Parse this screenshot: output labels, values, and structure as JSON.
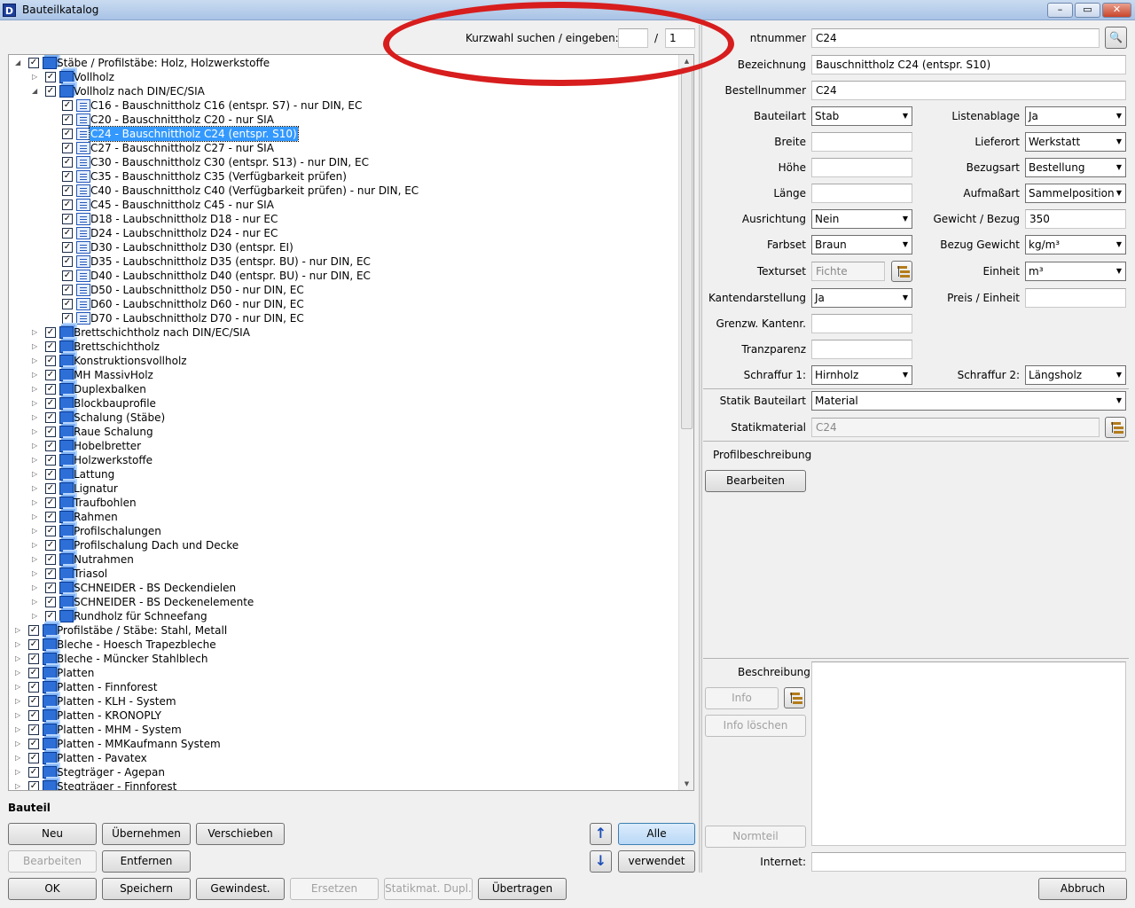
{
  "window": {
    "title": "Bauteilkatalog",
    "controls": [
      "–",
      "▭",
      "✕"
    ]
  },
  "search": {
    "label": "Kurzwahl suchen / eingeben:",
    "value": "",
    "separator": "/",
    "count": "1"
  },
  "tree": {
    "items": [
      {
        "label": "Stäbe / Profilstäbe: Holz, Holzwerkstoffe",
        "level": 0,
        "expanded": true,
        "type": "folder"
      },
      {
        "label": "Vollholz",
        "level": 1,
        "expanded": false,
        "type": "folder"
      },
      {
        "label": "Vollholz nach DIN/EC/SIA",
        "level": 1,
        "expanded": true,
        "type": "folder"
      },
      {
        "label": "C16 - Bauschnittholz C16 (entspr. S7) - nur DIN, EC",
        "level": 2,
        "type": "item"
      },
      {
        "label": "C20 - Bauschnittholz C20 - nur SIA",
        "level": 2,
        "type": "item"
      },
      {
        "label": "C24 - Bauschnittholz C24 (entspr. S10)",
        "level": 2,
        "type": "item",
        "selected": true
      },
      {
        "label": "C27 - Bauschnittholz C27 - nur SIA",
        "level": 2,
        "type": "item"
      },
      {
        "label": "C30 - Bauschnittholz C30 (entspr. S13) - nur DIN, EC",
        "level": 2,
        "type": "item"
      },
      {
        "label": "C35 - Bauschnittholz C35 (Verfügbarkeit prüfen)",
        "level": 2,
        "type": "item"
      },
      {
        "label": "C40 - Bauschnittholz C40 (Verfügbarkeit prüfen) - nur DIN, EC",
        "level": 2,
        "type": "item"
      },
      {
        "label": "C45 - Bauschnittholz C45 - nur SIA",
        "level": 2,
        "type": "item"
      },
      {
        "label": "D18 - Laubschnittholz D18 - nur EC",
        "level": 2,
        "type": "item"
      },
      {
        "label": "D24 - Laubschnittholz D24 - nur EC",
        "level": 2,
        "type": "item"
      },
      {
        "label": "D30 - Laubschnittholz D30 (entspr. EI)",
        "level": 2,
        "type": "item"
      },
      {
        "label": "D35 - Laubschnittholz D35 (entspr. BU) - nur DIN, EC",
        "level": 2,
        "type": "item"
      },
      {
        "label": "D40 - Laubschnittholz D40 (entspr. BU) - nur DIN, EC",
        "level": 2,
        "type": "item"
      },
      {
        "label": "D50 - Laubschnittholz D50 - nur DIN, EC",
        "level": 2,
        "type": "item"
      },
      {
        "label": "D60 - Laubschnittholz D60 - nur DIN, EC",
        "level": 2,
        "type": "item"
      },
      {
        "label": "D70 - Laubschnittholz D70 - nur DIN, EC",
        "level": 2,
        "type": "item"
      },
      {
        "label": "Brettschichtholz nach DIN/EC/SIA",
        "level": 1,
        "expanded": false,
        "type": "folder"
      },
      {
        "label": "Brettschichtholz",
        "level": 1,
        "expanded": false,
        "type": "folder"
      },
      {
        "label": "Konstruktionsvollholz",
        "level": 1,
        "expanded": false,
        "type": "folder"
      },
      {
        "label": "MH MassivHolz",
        "level": 1,
        "expanded": false,
        "type": "folder"
      },
      {
        "label": "Duplexbalken",
        "level": 1,
        "expanded": false,
        "type": "folder"
      },
      {
        "label": "Blockbauprofile",
        "level": 1,
        "expanded": false,
        "type": "folder"
      },
      {
        "label": "Schalung (Stäbe)",
        "level": 1,
        "expanded": false,
        "type": "folder"
      },
      {
        "label": "Raue Schalung",
        "level": 1,
        "expanded": false,
        "type": "folder"
      },
      {
        "label": "Hobelbretter",
        "level": 1,
        "expanded": false,
        "type": "folder"
      },
      {
        "label": "Holzwerkstoffe",
        "level": 1,
        "expanded": false,
        "type": "folder"
      },
      {
        "label": "Lattung",
        "level": 1,
        "expanded": false,
        "type": "folder"
      },
      {
        "label": "Lignatur",
        "level": 1,
        "expanded": false,
        "type": "folder"
      },
      {
        "label": "Traufbohlen",
        "level": 1,
        "expanded": false,
        "type": "folder"
      },
      {
        "label": "Rahmen",
        "level": 1,
        "expanded": false,
        "type": "folder"
      },
      {
        "label": "Profilschalungen",
        "level": 1,
        "expanded": false,
        "type": "folder"
      },
      {
        "label": "Profilschalung Dach und Decke",
        "level": 1,
        "expanded": false,
        "type": "folder"
      },
      {
        "label": "Nutrahmen",
        "level": 1,
        "expanded": false,
        "type": "folder"
      },
      {
        "label": "Triasol",
        "level": 1,
        "expanded": false,
        "type": "folder"
      },
      {
        "label": "SCHNEIDER - BS Deckendielen",
        "level": 1,
        "expanded": false,
        "type": "folder"
      },
      {
        "label": "SCHNEIDER - BS Deckenelemente",
        "level": 1,
        "expanded": false,
        "type": "folder"
      },
      {
        "label": "Rundholz für Schneefang",
        "level": 1,
        "expanded": false,
        "type": "folder"
      },
      {
        "label": "Profilstäbe / Stäbe: Stahl, Metall",
        "level": 0,
        "expanded": false,
        "type": "folder"
      },
      {
        "label": "Bleche - Hoesch Trapezbleche",
        "level": 0,
        "expanded": false,
        "type": "folder"
      },
      {
        "label": "Bleche - Müncker Stahlblech",
        "level": 0,
        "expanded": false,
        "type": "folder"
      },
      {
        "label": "Platten",
        "level": 0,
        "expanded": false,
        "type": "folder"
      },
      {
        "label": "Platten - Finnforest",
        "level": 0,
        "expanded": false,
        "type": "folder"
      },
      {
        "label": "Platten - KLH - System",
        "level": 0,
        "expanded": false,
        "type": "folder"
      },
      {
        "label": "Platten - KRONOPLY",
        "level": 0,
        "expanded": false,
        "type": "folder"
      },
      {
        "label": "Platten - MHM - System",
        "level": 0,
        "expanded": false,
        "type": "folder"
      },
      {
        "label": "Platten - MMKaufmann System",
        "level": 0,
        "expanded": false,
        "type": "folder"
      },
      {
        "label": "Platten - Pavatex",
        "level": 0,
        "expanded": false,
        "type": "folder"
      },
      {
        "label": "Stegträger - Agepan",
        "level": 0,
        "expanded": false,
        "type": "folder"
      },
      {
        "label": "Stegträger - Finnforest",
        "level": 0,
        "expanded": false,
        "type": "folder"
      }
    ]
  },
  "bauteil": {
    "heading": "Bauteil",
    "buttons": {
      "neu": "Neu",
      "uebernehmen": "Übernehmen",
      "verschieben": "Verschieben",
      "bearbeiten": "Bearbeiten",
      "entfernen": "Entfernen",
      "alle": "Alle",
      "verwendet": "verwendet"
    }
  },
  "footer": {
    "ok": "OK",
    "speichern": "Speichern",
    "gewindest": "Gewindest.",
    "ersetzen": "Ersetzen",
    "statikmat": "Statikmat. Dupl.",
    "uebertragen": "Übertragen",
    "abbruch": "Abbruch"
  },
  "form": {
    "artikelnummer": {
      "label": "ntnummer",
      "value": "C24"
    },
    "bezeichnung": {
      "label": "Bezeichnung",
      "value": "Bauschnittholz C24 (entspr. S10)"
    },
    "bestellnummer": {
      "label": "Bestellnummer",
      "value": "C24"
    },
    "bauteilart": {
      "label": "Bauteilart",
      "value": "Stab"
    },
    "listenablage": {
      "label": "Listenablage",
      "value": "Ja"
    },
    "breite": {
      "label": "Breite",
      "value": ""
    },
    "lieferort": {
      "label": "Lieferort",
      "value": "Werkstatt"
    },
    "hoehe": {
      "label": "Höhe",
      "value": ""
    },
    "bezugsart": {
      "label": "Bezugsart",
      "value": "Bestellung"
    },
    "laenge": {
      "label": "Länge",
      "value": ""
    },
    "aufmassart": {
      "label": "Aufmaßart",
      "value": "Sammelposition"
    },
    "ausrichtung": {
      "label": "Ausrichtung",
      "value": "Nein"
    },
    "gewicht": {
      "label": "Gewicht / Bezug",
      "value": "350"
    },
    "farbset": {
      "label": "Farbset",
      "value": "Braun"
    },
    "bezug_gewicht": {
      "label": "Bezug Gewicht",
      "value": "kg/m³"
    },
    "texturset": {
      "label": "Texturset",
      "value": "Fichte"
    },
    "einheit": {
      "label": "Einheit",
      "value": "m³"
    },
    "kantendarstellung": {
      "label": "Kantendarstellung",
      "value": "Ja"
    },
    "preis": {
      "label": "Preis / Einheit",
      "value": ""
    },
    "grenzw": {
      "label": "Grenzw. Kantenr.",
      "value": ""
    },
    "tranzparenz": {
      "label": "Tranzparenz",
      "value": ""
    },
    "schraffur1": {
      "label": "Schraffur 1:",
      "value": "Hirnholz"
    },
    "schraffur2": {
      "label": "Schraffur 2:",
      "value": "Längsholz"
    },
    "statik_bauteilart": {
      "label": "Statik Bauteilart",
      "value": "Material"
    },
    "statikmaterial": {
      "label": "Statikmaterial",
      "value": "C24"
    },
    "profilbeschreibung": {
      "label": "Profilbeschreibung",
      "button": "Bearbeiten"
    },
    "beschreibung": {
      "label": "Beschreibung",
      "value": ""
    },
    "info_button": "Info",
    "info_loeschen": "Info löschen",
    "normteil": "Normteil",
    "internet": {
      "label": "Internet:",
      "value": ""
    }
  }
}
